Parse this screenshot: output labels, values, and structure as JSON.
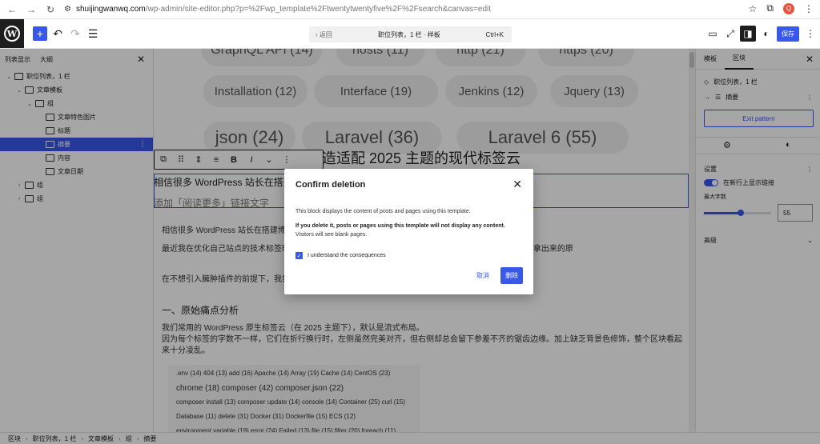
{
  "browser": {
    "host": "shuijingwanwq.com",
    "path": "/wp-admin/site-editor.php?p=%2Fwp_template%2Ftwentytwentyfive%2F%2Fsearch&canvas=edit",
    "back_icon": "←",
    "forward_icon": "→",
    "reload_icon": "↻",
    "avatar": "Q"
  },
  "toolbar": {
    "add_icon": "+",
    "undo_icon": "↶",
    "redo_icon": "↷",
    "list_icon": "☰",
    "doc_back": "‹ 返回",
    "doc_title": "职位列表，1 栏 · 样板",
    "doc_shortcut": "Ctrl+K",
    "save_label": "保存"
  },
  "left_panel": {
    "tab_list": "列表显示",
    "tab_outline": "大纲",
    "items": [
      {
        "label": "职位列表，1 栏",
        "indent": 0,
        "chev": "⌄"
      },
      {
        "label": "文章模板",
        "indent": 1,
        "chev": "⌄"
      },
      {
        "label": "组",
        "indent": 2,
        "chev": "⌄"
      },
      {
        "label": "文章特色图片",
        "indent": 3,
        "chev": ""
      },
      {
        "label": "标题",
        "indent": 3,
        "chev": ""
      },
      {
        "label": "摘要",
        "indent": 3,
        "chev": "",
        "selected": true
      },
      {
        "label": "内容",
        "indent": 3,
        "chev": ""
      },
      {
        "label": "文章日期",
        "indent": 3,
        "chev": ""
      },
      {
        "label": "组",
        "indent": 1,
        "chev": "›"
      },
      {
        "label": "组",
        "indent": 1,
        "chev": "›"
      }
    ]
  },
  "canvas": {
    "tags_top": [
      "GraphQL API (14)",
      "hosts (11)",
      "http (21)",
      "https (20)"
    ],
    "tags_mid": [
      "Installation (12)",
      "Interface (19)",
      "Jenkins (12)",
      "Jquery (13)"
    ],
    "tags_bottom": [
      "json (24)",
      "Laravel (36)",
      "Laravel 6 (55)"
    ],
    "title": "造适配 2025 主题的现代标签云",
    "excerpt": "相信很多 WordPress 站长在搭建博客时 ... 标签云区块。 [...",
    "read_more": "添加「阅读更多」链接文字",
    "para1": "相信很多 WordPress 站长在搭建博客",
    "para2": "最近我在优化自己站点的技术标签时 ... 方还有很难看的下划线；整体缺乏层级关系，就像是草稿箱里直接拿出来的原",
    "para3": "在不想引入臃肿插件的前提下，我尝 ... 签风格。今天就把优化思路和代码分享出来。",
    "heading": "一、原始痛点分析",
    "para4": "我们常用的 WordPress 原生标签云（在 2025 主题下），默认是流式布局。",
    "para5": "因为每个标签的字数不一样，它们在折行换行时，左侧虽然完美对齐，但右侧却总会留下参差不齐的锯齿边缘。加上缺乏背景色修饰，整个区块看起来十分凌乱。",
    "cloud_rows": [
      ".env (14)  404 (13)  add (16)  Apache (14)  Array (19)  Cache (14)  CentOS (23)",
      "chrome (18)  composer (42)  composer.json (22)",
      "composer install (13)  composer update (14)  console (14)  Container (25)  curl (15)",
      "Database (11)  delete (31)  Docker (31)  Dockerfile (15)  ECS (12)",
      "environment variable (19)  error (24)  Failed (13)  file (15)  filter (20)  foreach (11)"
    ]
  },
  "right_panel": {
    "tab_template": "模板",
    "tab_block": "区块",
    "pattern_name": "职位列表，1 栏",
    "block_name": "摘要",
    "exit_label": "Exit pattern",
    "settings_label": "设置",
    "toggle_label": "在新行上显示链接",
    "max_words_label": "最大字数",
    "max_words_value": "55",
    "advanced_label": "高级"
  },
  "footer": {
    "crumbs": [
      "区块",
      "职位列表，1 栏",
      "文章模板",
      "组",
      "摘要"
    ]
  },
  "modal": {
    "title": "Confirm deletion",
    "p1": "This block displays the content of posts and pages using this template.",
    "p2": "If you delete it, posts or pages using this template will not display any content.",
    "p3": "Visitors will see blank pages.",
    "checkbox_label": "I understand the consequences",
    "cancel": "取消",
    "delete": "删除"
  }
}
